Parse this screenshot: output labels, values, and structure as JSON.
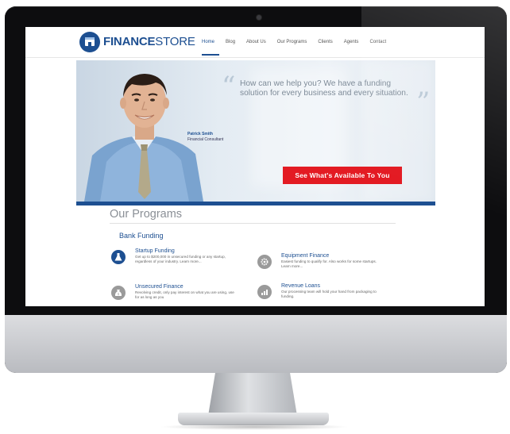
{
  "nav": {
    "logo_bold": "FINANCE",
    "logo_light": "STORE",
    "links": [
      "Home",
      "Blog",
      "About Us",
      "Our Programs",
      "Clients",
      "Agents",
      "Contact"
    ]
  },
  "hero": {
    "quote": "How can we help you? We have a funding solution for every business and every situation.",
    "person_name": "Patrick Smith",
    "person_title": "Financial Consultant",
    "cta_label": "See What's Available To You"
  },
  "programs": {
    "title": "Our Programs",
    "section": "Bank Funding",
    "items": [
      {
        "title": "Startup Funding",
        "desc": "Get up to $200,000 in unsecured funding or any startup, regardless of your industry. Learn more..."
      },
      {
        "title": "Equipment Finance",
        "desc": "Easiest funding to qualify for. Also works for some startups. Learn more..."
      },
      {
        "title": "Unsecured Finance",
        "desc": "Revolving credit, only pay interest on what you are using, use for as long as you"
      },
      {
        "title": "Revenue Loans",
        "desc": "Our processing team will hold your hand from packaging to funding."
      }
    ]
  },
  "colors": {
    "brand": "#1d4f91",
    "cta": "#e31b23",
    "muted": "#8a8f96"
  },
  "icons": [
    "finance-store-logo-icon",
    "flask-icon",
    "gear-icon",
    "money-bag-icon",
    "chart-icon"
  ]
}
